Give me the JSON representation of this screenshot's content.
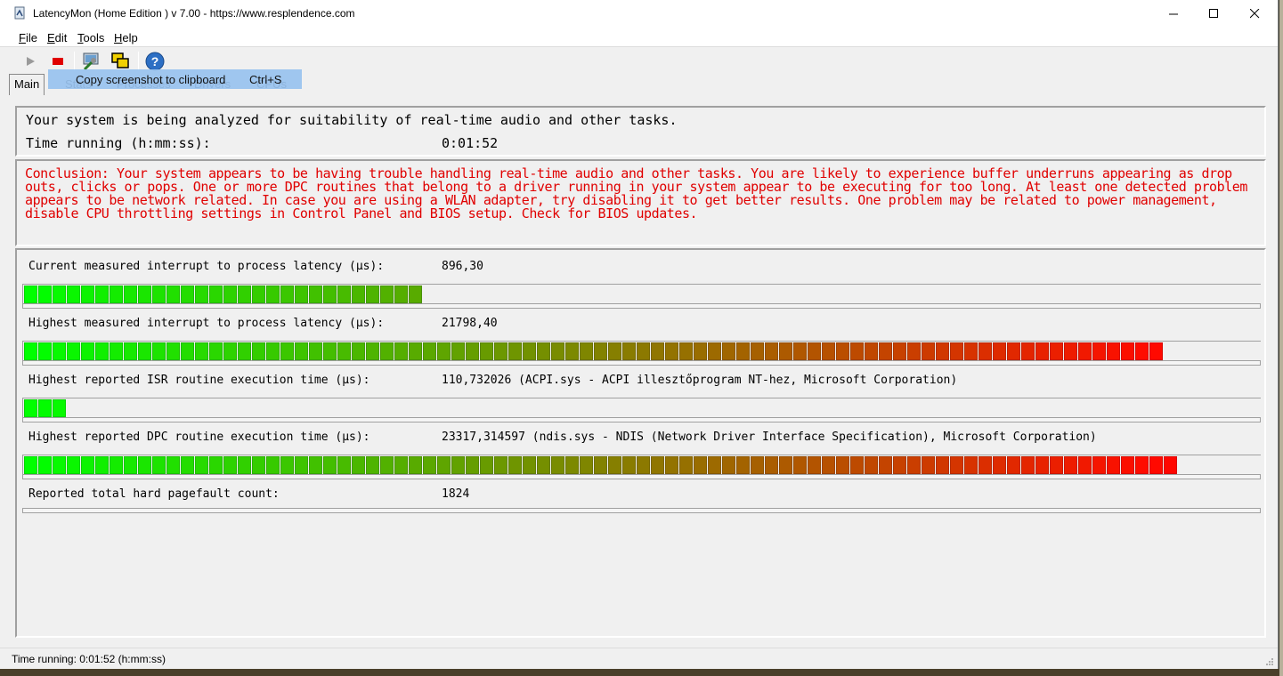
{
  "window": {
    "title": "LatencyMon  (Home Edition )  v 7.00 - https://www.resplendence.com"
  },
  "menu": [
    {
      "label": "File",
      "accel": "F",
      "rest": "ile"
    },
    {
      "label": "Edit",
      "accel": "E",
      "rest": "dit"
    },
    {
      "label": "Tools",
      "accel": "T",
      "rest": "ools"
    },
    {
      "label": "Help",
      "accel": "H",
      "rest": "elp"
    }
  ],
  "tabs": [
    "Main",
    "Stats",
    "Processes",
    "Drivers",
    "CPUs"
  ],
  "tooltip": {
    "label": "Copy screenshot to clipboard",
    "shortcut": "Ctrl+S"
  },
  "status": {
    "analysis_text": "Your system is being analyzed for suitability of real-time audio and other tasks.",
    "time_label": "Time running (h:mm:ss):",
    "time_value": "0:01:52"
  },
  "conclusion": "Conclusion: Your system appears to be having trouble handling real-time audio and other tasks. You are likely to experience buffer underruns appearing as drop outs, clicks or pops. One or more DPC routines that belong to a driver running in your system appear to be executing for too long. At least one detected problem appears to be network related. In case you are using a WLAN adapter, try disabling it to get better results. One problem may be related to power management, disable CPU throttling settings in Control Panel and BIOS setup. Check for BIOS updates.",
  "metrics": [
    {
      "label": "Current measured interrupt to process latency (µs):",
      "value": "896,30",
      "bar_fraction": 0.32
    },
    {
      "label": "Highest measured interrupt to process latency (µs):",
      "value": "21798,40",
      "bar_fraction": 0.933
    },
    {
      "label": "Highest reported ISR routine execution time (µs):",
      "value": "110,732026  (ACPI.sys - ACPI illesztőprogram NT-hez, Microsoft Corporation)",
      "bar_fraction": 0.033
    },
    {
      "label": "Highest reported DPC routine execution time (µs):",
      "value": "23317,314597  (ndis.sys - NDIS (Network Driver Interface Specification), Microsoft Corporation)",
      "bar_fraction": 0.944
    },
    {
      "label": "Reported total hard pagefault count:",
      "value": "1824",
      "bar_fraction": 0
    }
  ],
  "statusbar": "Time running: 0:01:52  (h:mm:ss)",
  "colors": {
    "conclusion_text": "#e00000",
    "bar_low": "#00ff00",
    "bar_high": "#ff0000",
    "tooltip_bg": "#99c3ef"
  }
}
